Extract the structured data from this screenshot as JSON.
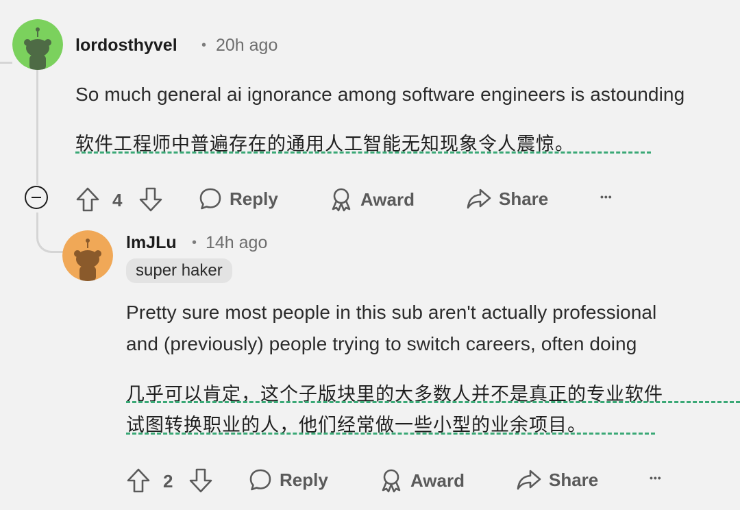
{
  "comment1": {
    "username": "lordosthyvel",
    "separator": "•",
    "time": "20h ago",
    "body": "So much general ai ignorance among software engineers is astounding",
    "translation": "软件工程师中普遍存在的通用人工智能无知现象令人震惊。",
    "votes": "4",
    "reply_label": "Reply",
    "award_label": "Award",
    "share_label": "Share",
    "more_label": "•••",
    "avatar_color": "#7bd15d"
  },
  "comment2": {
    "username": "lmJLu",
    "separator": "•",
    "time": "14h ago",
    "flair": "super haker",
    "body_line1": "Pretty sure most people in this sub aren't actually professional",
    "body_line2": "and (previously) people trying to switch careers, often doing",
    "translation_line1": "几乎可以肯定，这个子版块里的大多数人并不是真正的专业软件",
    "translation_line2": "试图转换职业的人，他们经常做一些小型的业余项目。",
    "votes": "2",
    "reply_label": "Reply",
    "award_label": "Award",
    "share_label": "Share",
    "more_label": "•••",
    "avatar_color": "#f0a857"
  },
  "colors": {
    "background": "#f2f2f2",
    "translation_underline": "#3aa876",
    "thread_line": "#d5d5d5"
  },
  "icons": [
    "snoo-avatar-icon",
    "upvote-icon",
    "downvote-icon",
    "reply-bubble-icon",
    "award-icon",
    "share-arrow-icon",
    "more-dots-icon",
    "collapse-minus-icon"
  ]
}
